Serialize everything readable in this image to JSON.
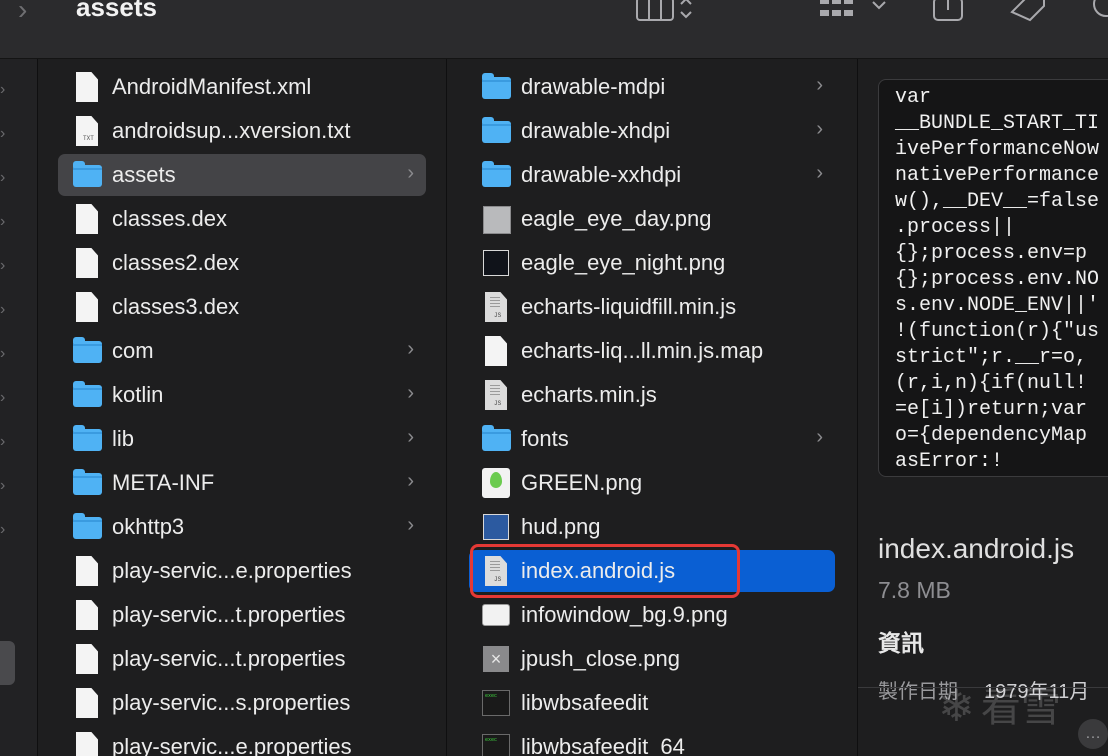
{
  "toolbar": {
    "back_glyph": "›",
    "title": "assets",
    "view_icon": "columns-view-icon",
    "group_icon": "group-grid-icon",
    "share_icon": "share-icon",
    "tag_icon": "tag-icon"
  },
  "column1": {
    "items": [
      {
        "label": "AndroidManifest.xml",
        "icon": "document-icon",
        "folder": false
      },
      {
        "label": "androidsup...xversion.txt",
        "icon": "text-file-icon",
        "folder": false
      },
      {
        "label": "assets",
        "icon": "folder-icon",
        "folder": true,
        "selected": true
      },
      {
        "label": "classes.dex",
        "icon": "document-icon",
        "folder": false
      },
      {
        "label": "classes2.dex",
        "icon": "document-icon",
        "folder": false
      },
      {
        "label": "classes3.dex",
        "icon": "document-icon",
        "folder": false
      },
      {
        "label": "com",
        "icon": "folder-icon",
        "folder": true
      },
      {
        "label": "kotlin",
        "icon": "folder-icon",
        "folder": true
      },
      {
        "label": "lib",
        "icon": "folder-icon",
        "folder": true
      },
      {
        "label": "META-INF",
        "icon": "folder-icon",
        "folder": true
      },
      {
        "label": "okhttp3",
        "icon": "folder-icon",
        "folder": true
      },
      {
        "label": "play-servic...e.properties",
        "icon": "document-icon",
        "folder": false
      },
      {
        "label": "play-servic...t.properties",
        "icon": "document-icon",
        "folder": false
      },
      {
        "label": "play-servic...t.properties",
        "icon": "document-icon",
        "folder": false
      },
      {
        "label": "play-servic...s.properties",
        "icon": "document-icon",
        "folder": false
      },
      {
        "label": "play-servic...e.properties",
        "icon": "document-icon",
        "folder": false
      }
    ]
  },
  "column2": {
    "items": [
      {
        "label": "drawable-mdpi",
        "icon": "folder-icon",
        "folder": true
      },
      {
        "label": "drawable-xhdpi",
        "icon": "folder-icon",
        "folder": true
      },
      {
        "label": "drawable-xxhdpi",
        "icon": "folder-icon",
        "folder": true
      },
      {
        "label": "eagle_eye_day.png",
        "icon": "image-gray-icon",
        "folder": false
      },
      {
        "label": "eagle_eye_night.png",
        "icon": "image-dark-icon",
        "folder": false
      },
      {
        "label": "echarts-liquidfill.min.js",
        "icon": "js-file-icon",
        "folder": false
      },
      {
        "label": "echarts-liq...ll.min.js.map",
        "icon": "document-icon",
        "folder": false
      },
      {
        "label": "echarts.min.js",
        "icon": "js-file-icon",
        "folder": false
      },
      {
        "label": "fonts",
        "icon": "folder-icon",
        "folder": true
      },
      {
        "label": "GREEN.png",
        "icon": "map-pin-image-icon",
        "folder": false
      },
      {
        "label": "hud.png",
        "icon": "image-blue-icon",
        "folder": false
      },
      {
        "label": "index.android.js",
        "icon": "js-file-icon",
        "folder": false,
        "selected": true
      },
      {
        "label": "infowindow_bg.9.png",
        "icon": "bubble-image-icon",
        "folder": false
      },
      {
        "label": "jpush_close.png",
        "icon": "close-image-icon",
        "folder": false
      },
      {
        "label": "libwbsafeedit",
        "icon": "exec-icon",
        "folder": false
      },
      {
        "label": "libwbsafeedit_64",
        "icon": "exec-icon",
        "folder": false
      }
    ]
  },
  "preview": {
    "code_lines": [
      "var",
      "__BUNDLE_START_TI",
      "ivePerformanceNow",
      "nativePerformance",
      "w(),__DEV__=false",
      ".process||",
      "{};process.env=p",
      "{};process.env.NO",
      "s.env.NODE_ENV||'",
      "!(function(r){\"us",
      "strict\";r.__r=o,",
      "(r,i,n){if(null!",
      "=e[i])return;var",
      "o={dependencyMap",
      "asError:!"
    ],
    "file_name": "index.android.js",
    "file_size": "7.8 MB",
    "info_heading": "資訊",
    "created_label": "製作日期",
    "created_value": "1979年11月",
    "watermark": "看雪"
  },
  "colors": {
    "selection_blue": "#0a5fd3",
    "folder_blue": "#4fb2f4",
    "highlight_red": "#e53935"
  }
}
